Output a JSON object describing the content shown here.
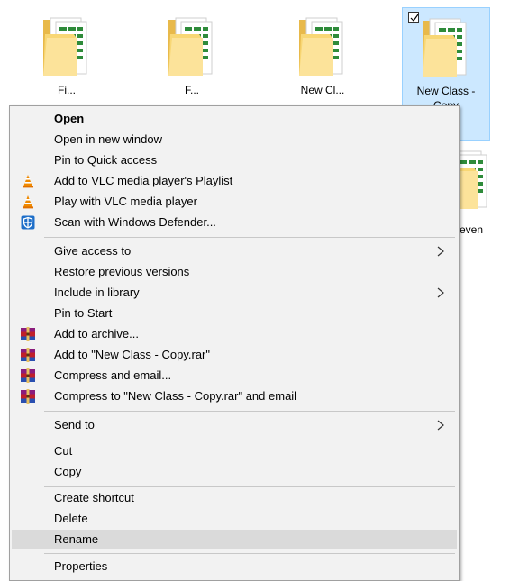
{
  "folders": [
    {
      "label": "Fi..."
    },
    {
      "label": "F..."
    },
    {
      "label": "New Cl..."
    },
    {
      "label": "New Class - Copy",
      "selected": true
    }
  ],
  "folder_row2": {
    "label": "even"
  },
  "menu": {
    "items": [
      {
        "label": "Open"
      },
      {
        "label": "Open in new window"
      },
      {
        "label": "Pin to Quick access"
      },
      {
        "label": "Add to VLC media player's Playlist",
        "icon": "vlc-cone-icon"
      },
      {
        "label": "Play with VLC media player",
        "icon": "vlc-cone-icon"
      },
      {
        "label": "Scan with Windows Defender...",
        "icon": "windows-defender-icon"
      },
      {
        "label": "Give access to",
        "submenu": true
      },
      {
        "label": "Restore previous versions"
      },
      {
        "label": "Include in library",
        "submenu": true
      },
      {
        "label": "Pin to Start"
      },
      {
        "label": "Add to archive...",
        "icon": "winrar-icon"
      },
      {
        "label": "Add to \"New Class - Copy.rar\"",
        "icon": "winrar-icon"
      },
      {
        "label": "Compress and email...",
        "icon": "winrar-icon"
      },
      {
        "label": "Compress to \"New Class - Copy.rar\" and email",
        "icon": "winrar-icon"
      },
      {
        "label": "Send to",
        "submenu": true
      },
      {
        "label": "Cut"
      },
      {
        "label": "Copy"
      },
      {
        "label": "Create shortcut"
      },
      {
        "label": "Delete"
      },
      {
        "label": "Rename",
        "highlighted": true
      },
      {
        "label": "Properties"
      }
    ]
  },
  "colors": {
    "selection": "#cce8ff",
    "menu_bg": "#f2f2f2",
    "hover": "#dadada",
    "folder": "#f8d775"
  }
}
